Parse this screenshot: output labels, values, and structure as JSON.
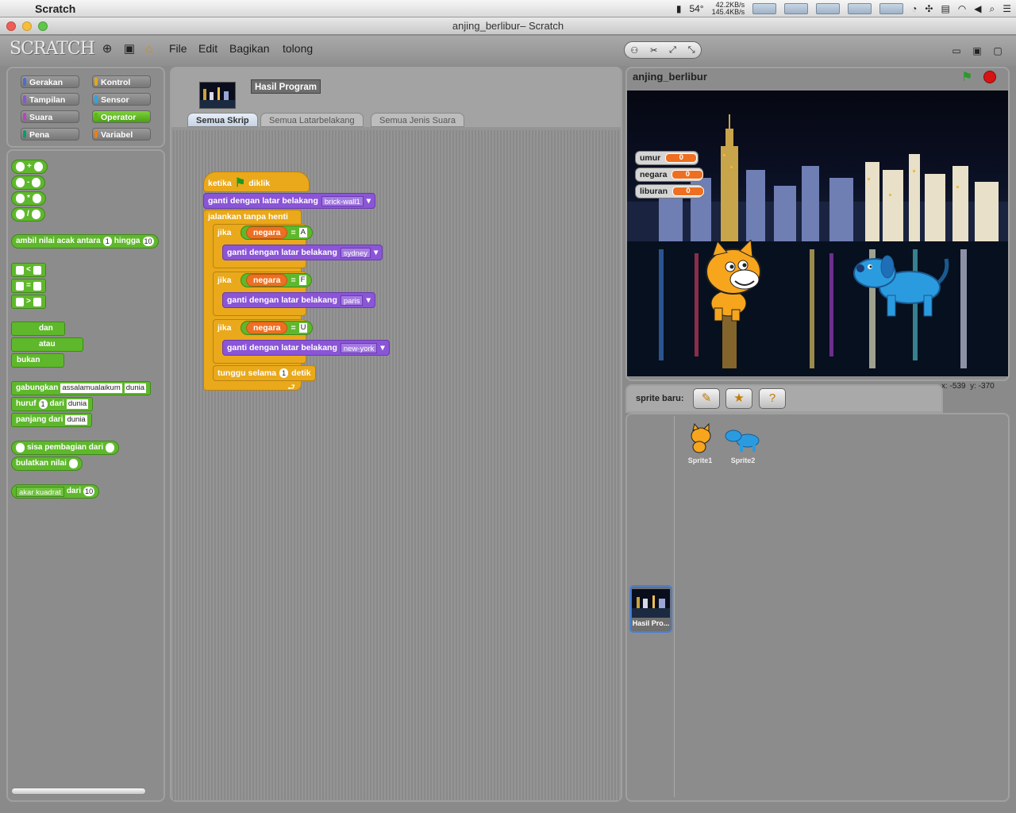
{
  "menubar": {
    "app": "Scratch",
    "temp": "54°",
    "net_up": "42.2KB/s",
    "net_down": "145.4KB/s"
  },
  "window": {
    "title": "anjing_berlibur– Scratch"
  },
  "toolbar": {
    "logo": "SCRATCH",
    "menus": [
      "File",
      "Edit",
      "Bagikan",
      "tolong"
    ]
  },
  "categories": [
    {
      "label": "Gerakan",
      "color": "#4a6cd4"
    },
    {
      "label": "Kontrol",
      "color": "#e1a91a"
    },
    {
      "label": "Tampilan",
      "color": "#8a55d7"
    },
    {
      "label": "Sensor",
      "color": "#2ca5e2"
    },
    {
      "label": "Suara",
      "color": "#bb42c3"
    },
    {
      "label": "Operator",
      "color": "#5cb712"
    },
    {
      "label": "Pena",
      "color": "#0e9a6c"
    },
    {
      "label": "Variabel",
      "color": "#ee7d16"
    }
  ],
  "palette": {
    "arith": [
      "+",
      "-",
      "*",
      "/"
    ],
    "random": {
      "label1": "ambil nilai acak antara",
      "v1": "1",
      "label2": "hingga",
      "v2": "10"
    },
    "compare": [
      "<",
      "=",
      ">"
    ],
    "logic": [
      "dan",
      "atau",
      "bukan"
    ],
    "join": {
      "label": "gabungkan",
      "a": "assalamualaikum",
      "b": "dunia"
    },
    "letter": {
      "label1": "huruf",
      "v": "1",
      "label2": "dari",
      "t": "dunia"
    },
    "length": {
      "label": "panjang dari",
      "t": "dunia"
    },
    "mod": {
      "label": "sisa pembagian dari"
    },
    "round": {
      "label": "bulatkan nilai"
    },
    "math": {
      "fn": "akar kuadrat",
      "label": "dari",
      "v": "10"
    }
  },
  "sprite": {
    "name": "Hasil Program"
  },
  "tabs": [
    "Semua Skrip",
    "Semua Latarbelakang",
    "Semua Jenis Suara"
  ],
  "script": {
    "hat": {
      "a": "ketika",
      "b": "diklik"
    },
    "switch_label": "ganti dengan latar belakang",
    "first_bg": "brick-wall1",
    "forever": "jalankan tanpa henti",
    "if_label": "jika",
    "var": "negara",
    "eq": "=",
    "ifs": [
      {
        "val": "A",
        "bg": "sydney"
      },
      {
        "val": "F",
        "bg": "paris"
      },
      {
        "val": "U",
        "bg": "new-york"
      }
    ],
    "wait": {
      "a": "tunggu selama",
      "v": "1",
      "b": "detik"
    }
  },
  "stage": {
    "title": "anjing_berlibur",
    "monitors": [
      {
        "name": "umur",
        "value": "0"
      },
      {
        "name": "negara",
        "value": "0"
      },
      {
        "name": "liburan",
        "value": "0"
      }
    ],
    "coords": {
      "x": "x: -539",
      "y": "y: -370"
    }
  },
  "sprites": {
    "new_label": "sprite baru:",
    "items": [
      "Sprite1",
      "Sprite2"
    ],
    "stage_label": "Hasil Pro..."
  }
}
